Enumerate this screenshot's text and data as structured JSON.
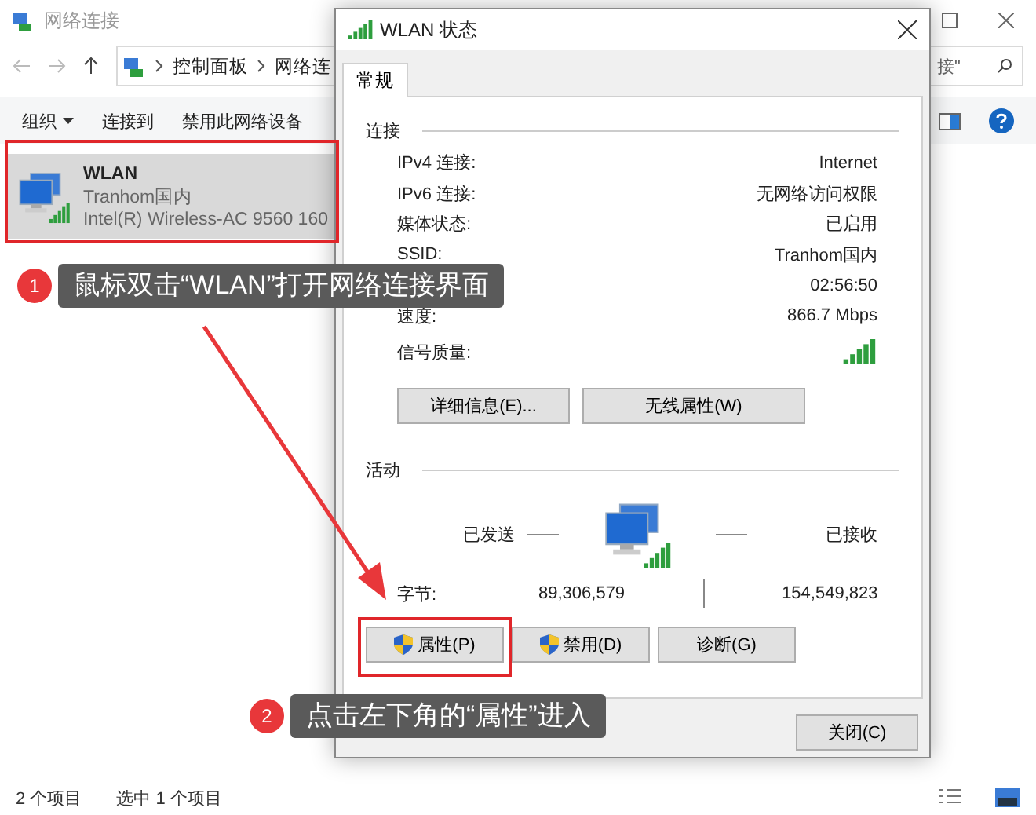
{
  "explorer": {
    "title": "网络连接",
    "breadcrumb": [
      "控制面板",
      "网络连"
    ],
    "search_text": "接\"",
    "toolbar": [
      {
        "label": "组织",
        "kind": "menu"
      },
      {
        "label": "连接到",
        "kind": "plain"
      },
      {
        "label": "禁用此网络设备",
        "kind": "plain"
      }
    ],
    "items": [
      {
        "name": "WLAN",
        "network": "Tranhom国内",
        "adapter": "Intel(R) Wireless-AC 9560 160",
        "selected": true
      }
    ],
    "status": [
      "2 个项目",
      "选中 1 个项目"
    ]
  },
  "dialog": {
    "title": "WLAN 状态",
    "tabs": [
      {
        "label": "常规",
        "selected": true
      }
    ],
    "connection": {
      "heading": "连接",
      "rows": [
        {
          "kind": "text",
          "label": "IPv4 连接:",
          "value": "Internet"
        },
        {
          "kind": "text",
          "label": "IPv6 连接:",
          "value": "无网络访问权限"
        },
        {
          "kind": "text",
          "label": "媒体状态:",
          "value": "已启用"
        },
        {
          "kind": "text",
          "label": "SSID:",
          "value": "Tranhom国内"
        },
        {
          "kind": "text",
          "value": "02:56:50"
        },
        {
          "kind": "text",
          "label": "速度:",
          "value": "866.7 Mbps"
        },
        {
          "kind": "signal",
          "label": "信号质量:"
        }
      ],
      "buttons": [
        "详细信息(E)...",
        "无线属性(W)"
      ]
    },
    "activity": {
      "heading": "活动",
      "sent_label": "已发送",
      "received_label": "已接收",
      "bytes_label": "字节:",
      "sent": "89,306,579",
      "received": "154,549,823"
    },
    "action_buttons": [
      {
        "label": "属性(P)",
        "shield": true
      },
      {
        "label": "禁用(D)",
        "shield": true
      },
      {
        "label": "诊断(G)",
        "shield": false
      }
    ],
    "close_button": "关闭(C)"
  },
  "annotations": [
    {
      "number": "1",
      "text": "鼠标双击“WLAN”打开网络连接界面"
    },
    {
      "number": "2",
      "text": "点击左下角的“属性”进入"
    }
  ]
}
